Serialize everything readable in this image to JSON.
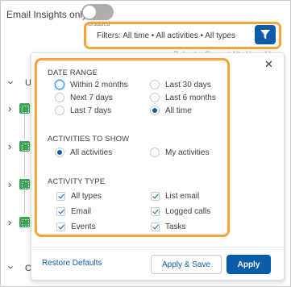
{
  "header": {
    "email_insights_label": "Email Insights only",
    "toggle_state_label": "Disabled",
    "filters_summary": "Filters: All time • All activities • All types",
    "filter_icon": "filter-funnel-icon",
    "ghost_text": "Refresh • Expand All • View All"
  },
  "background": {
    "group_letters": [
      "U",
      "O"
    ]
  },
  "panel": {
    "close_icon": "close-icon",
    "date_range": {
      "title": "DATE RANGE",
      "options": [
        "Within 2 months",
        "Last 30 days",
        "Next 7 days",
        "Last 6 months",
        "Last 7 days",
        "All time"
      ],
      "selected": "All time",
      "focused": "Within 2 months"
    },
    "activities": {
      "title": "ACTIVITIES TO SHOW",
      "options": [
        "All activities",
        "My activities"
      ],
      "selected": "All activities"
    },
    "activity_type": {
      "title": "ACTIVITY TYPE",
      "options": [
        "All types",
        "List email",
        "Email",
        "Logged calls",
        "Events",
        "Tasks"
      ],
      "checked": [
        true,
        true,
        true,
        true,
        true,
        true
      ]
    },
    "footer": {
      "restore_label": "Restore Defaults",
      "apply_save_label": "Apply & Save",
      "apply_label": "Apply"
    }
  },
  "colors": {
    "accent": "#0b5cab",
    "highlight": "#f4a53b",
    "activity_green": "#3ba755"
  }
}
